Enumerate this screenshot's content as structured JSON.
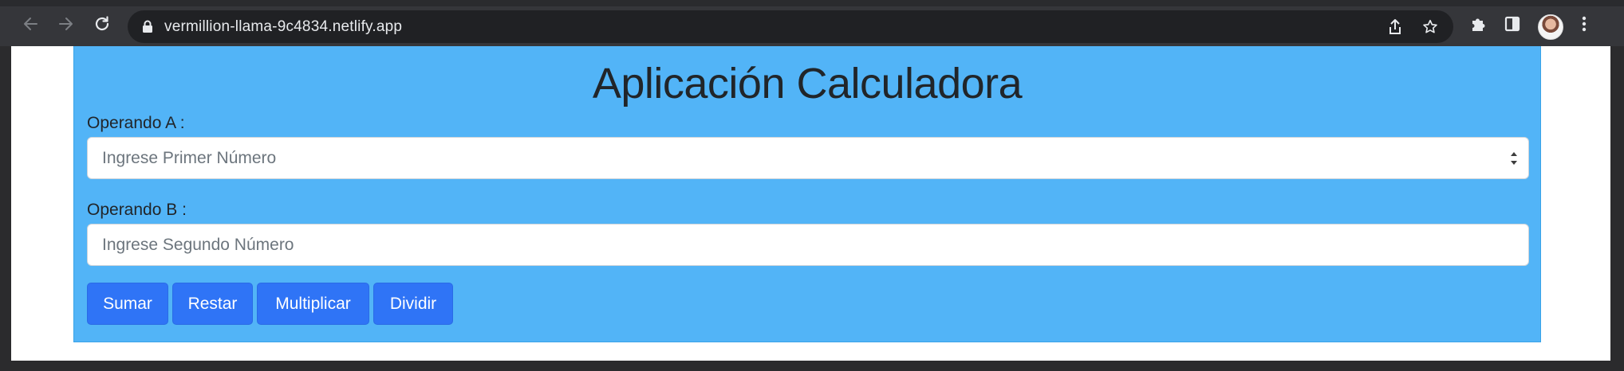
{
  "browser": {
    "url": "vermillion-llama-9c4834.netlify.app",
    "icons": [
      "back-arrow-icon",
      "forward-arrow-icon",
      "reload-icon",
      "lock-icon",
      "share-icon",
      "bookmark-star-icon",
      "extensions-puzzle-icon",
      "side-panel-icon",
      "profile-avatar",
      "more-menu-icon"
    ]
  },
  "app": {
    "title": "Aplicación Calculadora",
    "operand_a": {
      "label": "Operando A :",
      "placeholder": "Ingrese Primer Número",
      "value": ""
    },
    "operand_b": {
      "label": "Operando B :",
      "placeholder": "Ingrese Segundo Número",
      "value": ""
    },
    "buttons": {
      "add": "Sumar",
      "subtract": "Restar",
      "multiply": "Multiplicar",
      "divide": "Dividir"
    }
  },
  "colors": {
    "card_background": "#52b4f7",
    "button_primary": "#2f74f6",
    "browser_chrome": "#35363a",
    "omnibox": "#202124"
  }
}
